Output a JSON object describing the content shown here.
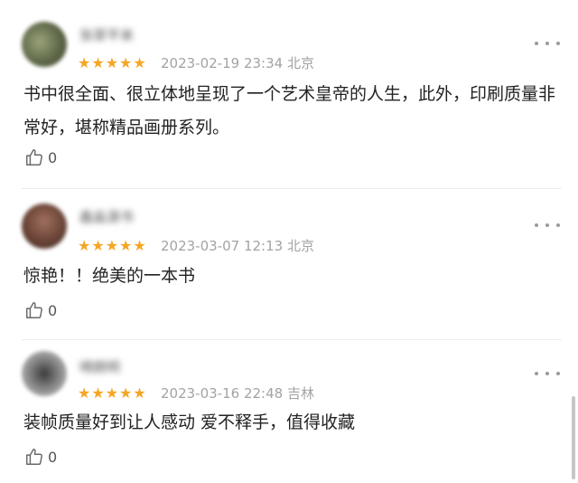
{
  "reviews": [
    {
      "username": "张翠平来",
      "stars": "★★★★★",
      "datetime": "2023-02-19 23:34",
      "location": "北京",
      "content": "书中很全面、很立体地呈现了一个艺术皇帝的人生，此外，印刷质量非常好，堪称精品画册系列。",
      "likes": "0",
      "avatar_color": "#6f7a5c"
    },
    {
      "username": "鑫淼源书",
      "stars": "★★★★★",
      "datetime": "2023-03-07 12:13",
      "location": "北京",
      "content": "惊艳！！绝美的一本书",
      "likes": "0",
      "avatar_color": "#6e4a3c"
    },
    {
      "username": "晴朗明",
      "stars": "★★★★★",
      "datetime": "2023-03-16 22:48",
      "location": "吉林",
      "content": "装帧质量好到让人感动 爱不释手，值得收藏",
      "likes": "0",
      "avatar_color": "#8a8a8a"
    }
  ],
  "colors": {
    "star": "#f5a623",
    "meta_text": "#a3a3a3"
  },
  "icons": {
    "like": "thumbs-up-icon",
    "more": "more-options-icon"
  }
}
